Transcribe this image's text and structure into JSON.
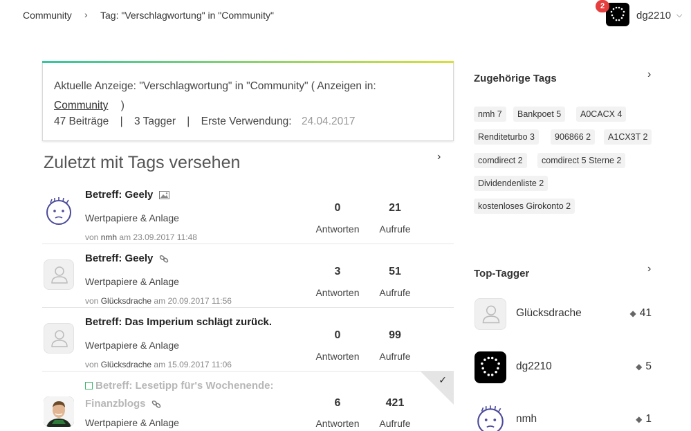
{
  "breadcrumb": {
    "home": "Community",
    "separator": "›",
    "current": "Tag: \"Verschlagwortung\" in \"Community\""
  },
  "user": {
    "name": "dg2210",
    "notifications": "2"
  },
  "info": {
    "prefix": "Aktuelle Anzeige: \"Verschlagwortung\" in \"Community\" ( Anzeigen in:",
    "link": "Community",
    "suffix": ")",
    "posts": "47 Beiträge",
    "taggers": "3 Tagger",
    "first_use_label": "Erste Verwendung:",
    "first_use_date": "24.04.2017"
  },
  "recent": {
    "title": "Zuletzt mit Tags versehen",
    "answers_label": "Antworten",
    "views_label": "Aufrufe",
    "by_label": "von",
    "at_label": "am",
    "posts": [
      {
        "title": "Betreff: Geely",
        "board": "Wertpapiere & Anlage",
        "author": "nmh",
        "date": "23.09.2017 11:48",
        "answers": "0",
        "views": "21",
        "icon": "image-icon"
      },
      {
        "title": "Betreff: Geely",
        "board": "Wertpapiere & Anlage",
        "author": "Glücksdrache",
        "date": "20.09.2017 11:56",
        "answers": "3",
        "views": "51",
        "icon": "link-icon"
      },
      {
        "title": "Betreff: Das Imperium schlägt zurück.",
        "board": "Wertpapiere & Anlage",
        "author": "Glücksdrache",
        "date": "15.09.2017 11:06",
        "answers": "0",
        "views": "99",
        "icon": ""
      },
      {
        "title_line1": "Betreff: Lesetipp für's Wochenende:",
        "title_line2": "Finanzblogs",
        "board": "Wertpapiere & Anlage",
        "answers": "6",
        "views": "421",
        "icon": "link-icon",
        "solved": true
      }
    ]
  },
  "related_tags": {
    "title": "Zugehörige Tags",
    "tags": [
      "nmh 7",
      "Bankpoet 5",
      "A0CACX 4",
      "Renditeturbo 3",
      "906866 2",
      "A1CX3T 2",
      "comdirect 2",
      "comdirect 5 Sterne 2",
      "Dividendenliste 2",
      "kostenloses Girokonto 2"
    ]
  },
  "top_taggers": {
    "title": "Top-Tagger",
    "items": [
      {
        "name": "Glücksdrache",
        "count": "41"
      },
      {
        "name": "dg2210",
        "count": "5"
      },
      {
        "name": "nmh",
        "count": "1"
      }
    ]
  }
}
